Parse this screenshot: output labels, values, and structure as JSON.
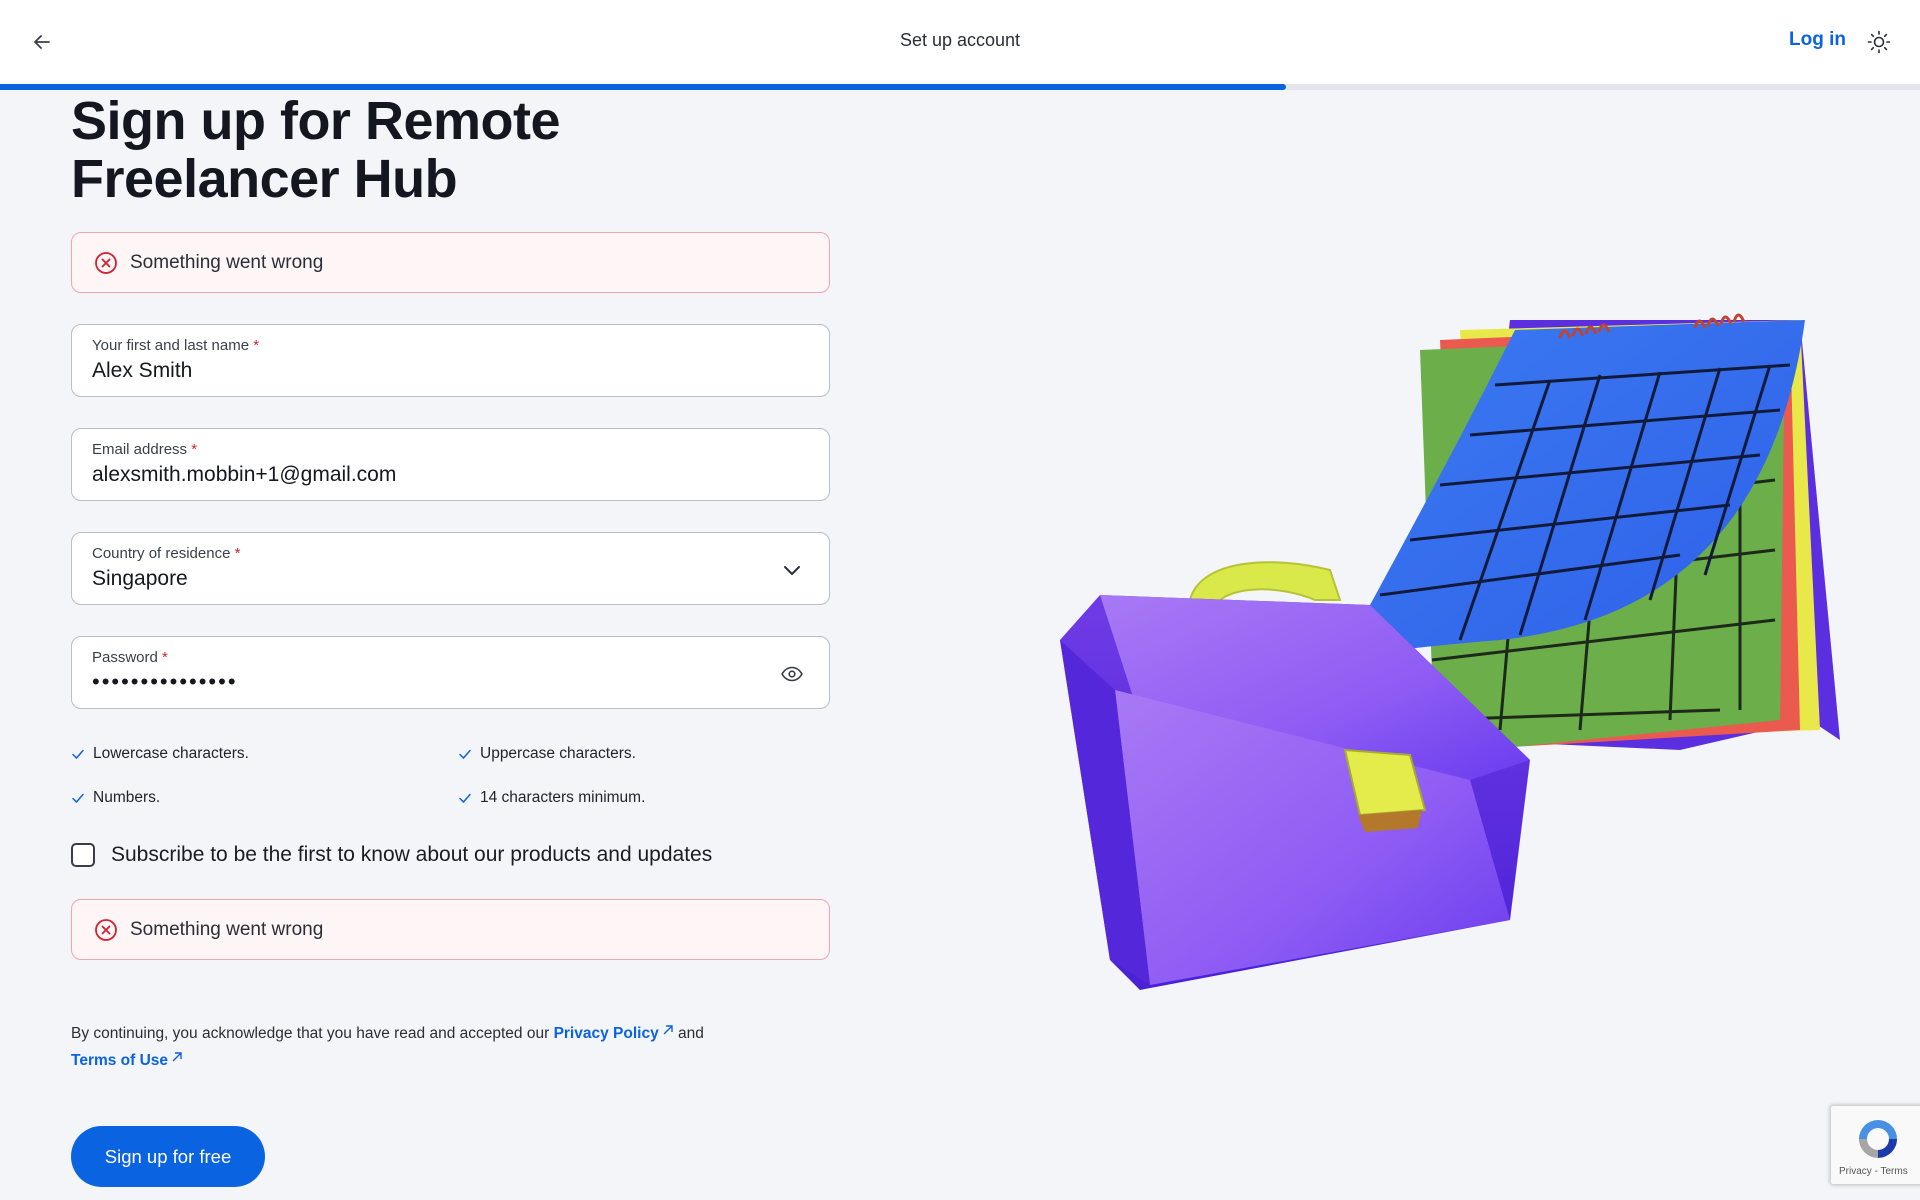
{
  "header": {
    "title": "Set up account",
    "login_label": "Log in",
    "progress_fraction": 0.67
  },
  "page": {
    "title_line1": "Sign up for Remote",
    "title_line2": "Freelancer Hub"
  },
  "alerts": {
    "top": "Something went wrong",
    "bottom": "Something went wrong"
  },
  "form": {
    "name": {
      "label": "Your first and last name",
      "value": "Alex Smith"
    },
    "email": {
      "label": "Email address",
      "value": "alexsmith.mobbin+1@gmail.com"
    },
    "country": {
      "label": "Country of residence",
      "value": "Singapore"
    },
    "password": {
      "label": "Password",
      "value": "•••••••••••••••"
    },
    "required_mark": "*"
  },
  "password_rules": [
    "Lowercase characters.",
    "Uppercase characters.",
    "Numbers.",
    "14 characters minimum."
  ],
  "subscribe": {
    "label": "Subscribe to be the first to know about our products and updates",
    "checked": false
  },
  "legal": {
    "prefix": "By continuing, you acknowledge that you have read and accepted our",
    "privacy_link": "Privacy Policy",
    "and": "and",
    "terms_link": "Terms of Use"
  },
  "submit_label": "Sign up for free",
  "recaptcha": {
    "text": "Privacy - Terms"
  },
  "colors": {
    "accent": "#0a63e0",
    "error": "#d3222f",
    "alert_bg": "#fdf5f6"
  }
}
